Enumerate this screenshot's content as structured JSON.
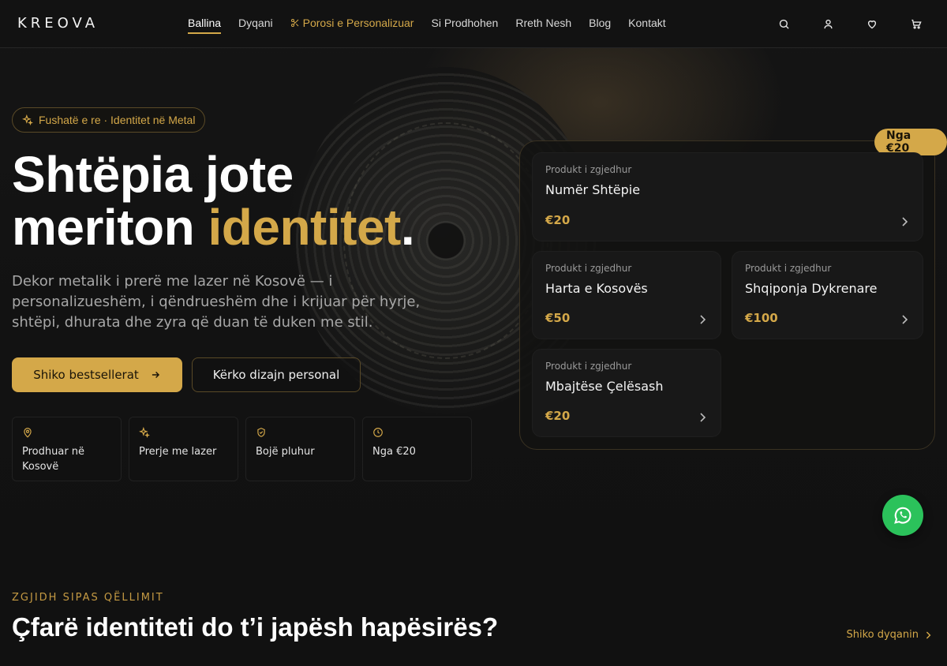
{
  "brand": {
    "logo": "KREOVA"
  },
  "nav": {
    "items": [
      {
        "label": "Ballina",
        "active": true
      },
      {
        "label": "Dyqani"
      },
      {
        "label": "Porosi e Personalizuar",
        "highlight": true,
        "icon": "scissors-icon"
      },
      {
        "label": "Si Prodhohen"
      },
      {
        "label": "Rreth Nesh"
      },
      {
        "label": "Blog"
      },
      {
        "label": "Kontakt"
      }
    ],
    "icons": [
      "search-icon",
      "user-icon",
      "heart-icon",
      "cart-icon"
    ]
  },
  "hero": {
    "badge": "Fushatë e re · Identitet në Metal",
    "title_line1": "Shtëpia jote",
    "title_line2_plain": "meriton ",
    "title_line2_accent": "identitet",
    "title_line2_end": ".",
    "lead": "Dekor metalik i prerë me lazer në Kosovë — i personalizueshëm, i qëndrueshëm dhe i krijuar për hyrje, shtëpi, dhurata dhe zyra që duan të duken me stil.",
    "cta_primary": "Shiko bestsellerat",
    "cta_secondary": "Kërko dizajn personal",
    "features": [
      {
        "icon": "map-pin-icon",
        "label": "Prodhuar në Kosovë"
      },
      {
        "icon": "sparkles-icon",
        "label": "Prerje me lazer"
      },
      {
        "icon": "shield-check-icon",
        "label": "Bojë pluhur"
      },
      {
        "icon": "clock-icon",
        "label": "Nga €20"
      }
    ]
  },
  "panel": {
    "price_badge": "Nga €20",
    "cards": [
      {
        "kicker": "Produkt i zgjedhur",
        "name": "Numër Shtëpie",
        "price": "€20"
      },
      {
        "kicker": "Produkt i zgjedhur",
        "name": "Harta e Kosovës",
        "price": "€50"
      },
      {
        "kicker": "Produkt i zgjedhur",
        "name": "Shqiponja Dykrenare",
        "price": "€100"
      },
      {
        "kicker": "Produkt i zgjedhur",
        "name": "Mbajtëse Çelësash",
        "price": "€20"
      }
    ]
  },
  "section": {
    "eyebrow": "ZGJIDH SIPAS QËLLIMIT",
    "title": "Çfarë identiteti do t’i japësh hapësirës?",
    "link": "Shiko dyqanin"
  },
  "colors": {
    "accent": "#d4a849",
    "background": "#111111",
    "whatsapp": "#2bc25b"
  }
}
